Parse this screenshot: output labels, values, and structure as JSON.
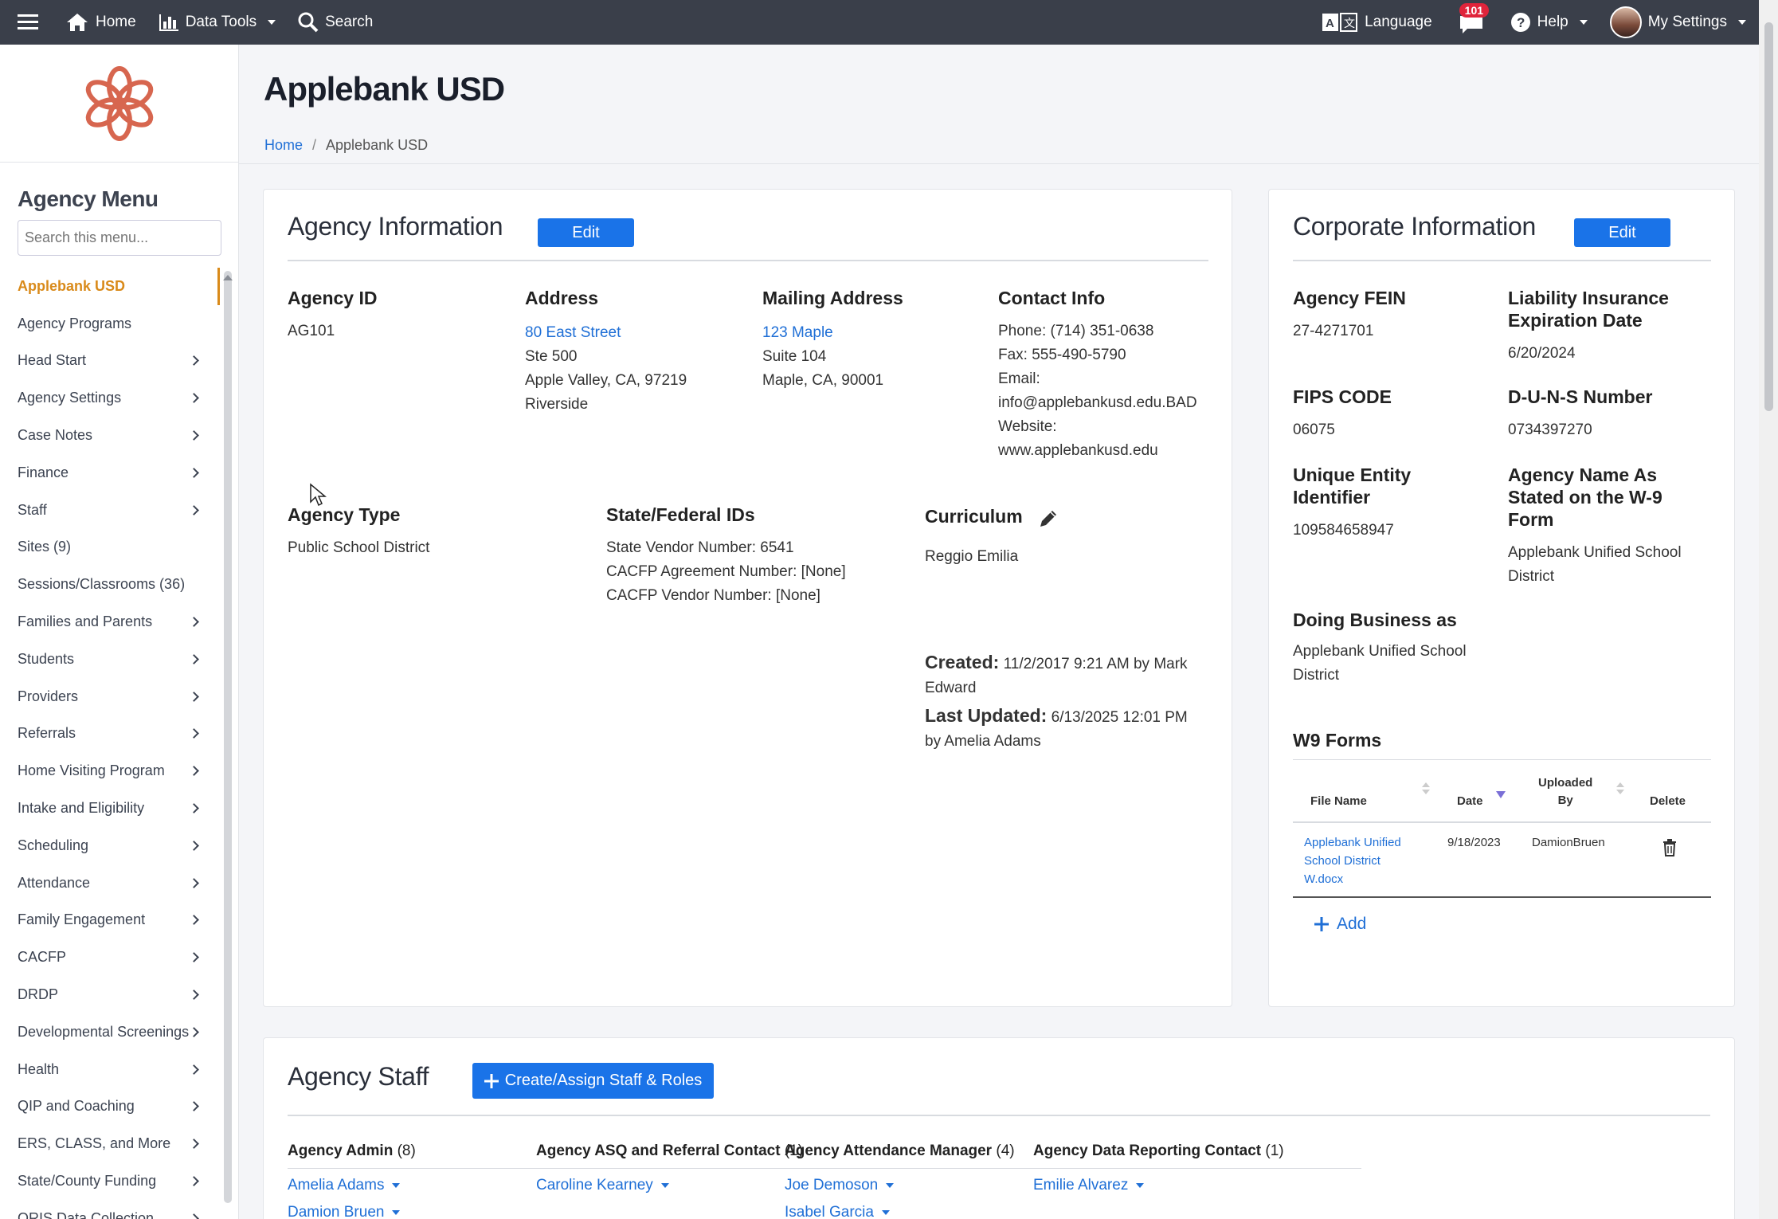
{
  "topnav": {
    "home": "Home",
    "data_tools": "Data Tools",
    "search": "Search",
    "language": "Language",
    "notifications_count": "101",
    "help": "Help",
    "my_settings": "My Settings"
  },
  "sidebar": {
    "title": "Agency Menu",
    "search_placeholder": "Search this menu...",
    "items": [
      {
        "label": "Applebank USD",
        "active": true,
        "submenu": false
      },
      {
        "label": "Agency Programs",
        "submenu": false
      },
      {
        "label": "Head Start",
        "submenu": true
      },
      {
        "label": "Agency Settings",
        "submenu": true
      },
      {
        "label": "Case Notes",
        "submenu": true
      },
      {
        "label": "Finance",
        "submenu": true
      },
      {
        "label": "Staff",
        "submenu": true
      },
      {
        "label": "Sites (9)",
        "submenu": false
      },
      {
        "label": "Sessions/Classrooms (36)",
        "submenu": false
      },
      {
        "label": "Families and Parents",
        "submenu": true
      },
      {
        "label": "Students",
        "submenu": true
      },
      {
        "label": "Providers",
        "submenu": true
      },
      {
        "label": "Referrals",
        "submenu": true
      },
      {
        "label": "Home Visiting Program",
        "submenu": true
      },
      {
        "label": "Intake and Eligibility",
        "submenu": true
      },
      {
        "label": "Scheduling",
        "submenu": true
      },
      {
        "label": "Attendance",
        "submenu": true
      },
      {
        "label": "Family Engagement",
        "submenu": true
      },
      {
        "label": "CACFP",
        "submenu": true
      },
      {
        "label": "DRDP",
        "submenu": true
      },
      {
        "label": "Developmental Screenings",
        "submenu": true
      },
      {
        "label": "Health",
        "submenu": true
      },
      {
        "label": "QIP and Coaching",
        "submenu": true
      },
      {
        "label": "ERS, CLASS, and More",
        "submenu": true
      },
      {
        "label": "State/County Funding",
        "submenu": true
      },
      {
        "label": "QRIS Data Collection",
        "submenu": true
      }
    ]
  },
  "header": {
    "title": "Applebank USD",
    "breadcrumb_home": "Home",
    "breadcrumb_current": "Applebank USD"
  },
  "agency_info": {
    "title": "Agency Information",
    "edit": "Edit",
    "agency_id_label": "Agency ID",
    "agency_id": "AG101",
    "address_label": "Address",
    "address_line1": "80 East Street",
    "address_line2": "Ste 500",
    "address_line3": "Apple Valley, CA, 97219",
    "address_line4": "Riverside",
    "mailing_label": "Mailing Address",
    "mailing_line1": "123 Maple",
    "mailing_line2": "Suite 104",
    "mailing_line3": "Maple, CA, 90001",
    "contact_label": "Contact Info",
    "phone": "Phone: (714) 351-0638",
    "fax": "Fax: 555-490-5790",
    "email_label": "Email:",
    "email": "info@applebankusd.edu.BAD",
    "website_label": "Website:",
    "website": "www.applebankusd.edu",
    "agency_type_label": "Agency Type",
    "agency_type": "Public School District",
    "ids_label": "State/Federal IDs",
    "state_vendor": "State Vendor Number: 6541",
    "cacfp_agreement": "CACFP Agreement Number: [None]",
    "cacfp_vendor": "CACFP Vendor Number: [None]",
    "curriculum_label": "Curriculum",
    "curriculum": "Reggio Emilia",
    "created_label": "Created:",
    "created_value": "11/2/2017 9:21 AM by Mark",
    "created_value2": "Edward",
    "updated_label": "Last Updated:",
    "updated_value": "6/13/2025 12:01 PM",
    "updated_value2": "by Amelia Adams"
  },
  "corporate_info": {
    "title": "Corporate Information",
    "edit": "Edit",
    "fein_label": "Agency FEIN",
    "fein": "27-4271701",
    "liability_label1": "Liability Insurance",
    "liability_label2": "Expiration Date",
    "liability": "6/20/2024",
    "fips_label": "FIPS CODE",
    "fips": "06075",
    "duns_label": "D-U-N-S Number",
    "duns": "0734397270",
    "uei_label1": "Unique Entity",
    "uei_label2": "Identifier",
    "uei": "109584658947",
    "w9name_label1": "Agency Name As",
    "w9name_label2": "Stated on the W-9",
    "w9name_label3": "Form",
    "w9name1": "Applebank Unified School",
    "w9name2": "District",
    "dba_label": "Doing Business as",
    "dba1": "Applebank Unified School",
    "dba2": "District",
    "w9_title": "W9 Forms",
    "w9_columns": {
      "file": "File Name",
      "date": "Date",
      "uploaded1": "Uploaded",
      "uploaded2": "By",
      "delete": "Delete"
    },
    "w9_row": {
      "file1": "Applebank Unified",
      "file2": "School District",
      "file3": "W.docx",
      "date": "9/18/2023",
      "by": "DamionBruen"
    },
    "add": "Add"
  },
  "staff": {
    "title": "Agency Staff",
    "create_button": "Create/Assign Staff & Roles",
    "roles": [
      {
        "name": "Agency Admin",
        "count": "(8)",
        "people": [
          "Amelia Adams",
          "Damion Bruen"
        ]
      },
      {
        "name": "Agency ASQ and Referral Contact",
        "count": "(1)",
        "people": [
          "Caroline Kearney"
        ]
      },
      {
        "name": "Agency Attendance Manager",
        "count": "(4)",
        "people": [
          "Joe Demoson",
          "Isabel Garcia"
        ]
      },
      {
        "name": "Agency Data Reporting Contact",
        "count": "(1)",
        "people": [
          "Emilie Alvarez"
        ]
      }
    ]
  },
  "colors": {
    "accent": "#1a73e8",
    "active_menu": "#d98a1a",
    "topnav": "#3a3f4a",
    "logo": "#d7664f",
    "badge": "#e0243b"
  }
}
